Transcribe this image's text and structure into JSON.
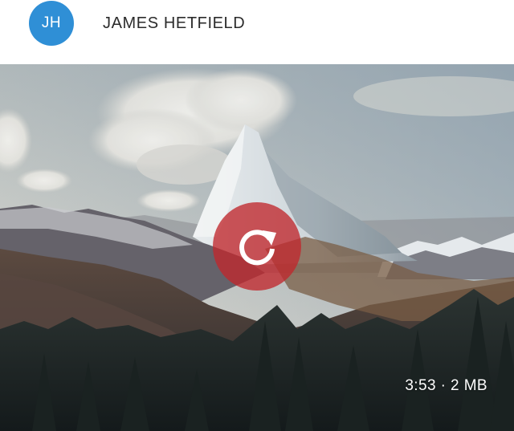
{
  "header": {
    "avatar": {
      "initials": "JH",
      "color": "#2f8fd6",
      "icon": "avatar"
    },
    "user_name": "JAMES HETFIELD"
  },
  "media": {
    "type": "image",
    "scene": "mountain-landscape",
    "retry_button": {
      "icon": "retry-icon",
      "color": "#c0282d"
    },
    "duration": "3:53",
    "separator": "·",
    "size": "2 MB"
  }
}
